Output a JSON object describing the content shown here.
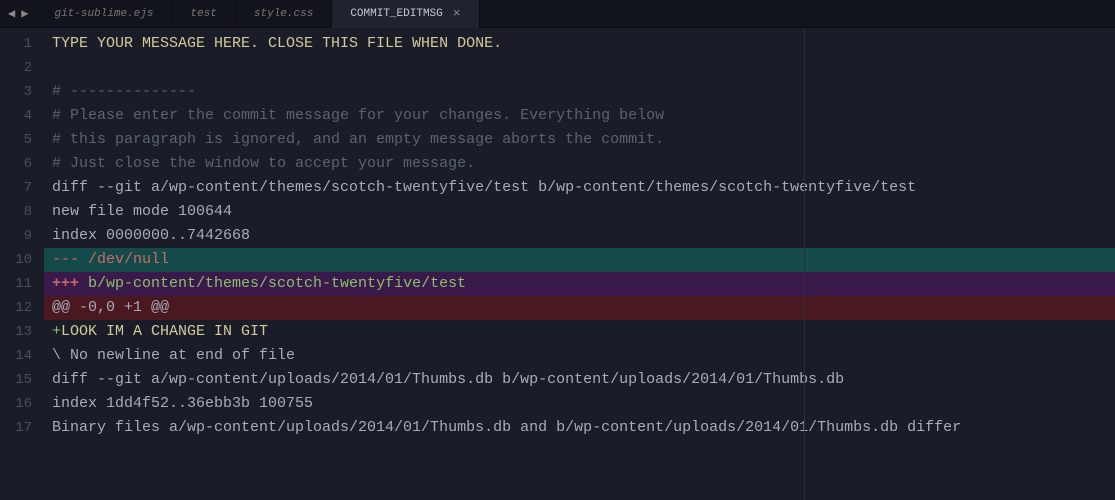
{
  "nav": {
    "back": "◀",
    "forward": "▶"
  },
  "tabs": [
    {
      "label": "git-sublime.ejs",
      "active": false
    },
    {
      "label": "test",
      "active": false
    },
    {
      "label": "style.css",
      "active": false
    },
    {
      "label": "COMMIT_EDITMSG",
      "active": true,
      "close": "×"
    }
  ],
  "editor": {
    "lines": [
      {
        "n": "1",
        "segs": [
          {
            "t": "TYPE YOUR MESSAGE HERE. CLOSE THIS FILE WHEN DONE.",
            "c": "c-wheat"
          }
        ]
      },
      {
        "n": "2",
        "segs": [
          {
            "t": "",
            "c": "c-plain"
          }
        ]
      },
      {
        "n": "3",
        "segs": [
          {
            "t": "# --------------",
            "c": "c-comment"
          }
        ]
      },
      {
        "n": "4",
        "segs": [
          {
            "t": "# Please enter the commit message for your changes. Everything below",
            "c": "c-comment"
          }
        ]
      },
      {
        "n": "5",
        "segs": [
          {
            "t": "# this paragraph is ignored, and an empty message aborts the commit.",
            "c": "c-comment"
          }
        ]
      },
      {
        "n": "6",
        "segs": [
          {
            "t": "# Just close the window to accept your message.",
            "c": "c-comment"
          }
        ]
      },
      {
        "n": "7",
        "segs": [
          {
            "t": "diff --git a/wp-content/themes/scotch-twentyfive/test b/wp-content/themes/scotch-twentyfive/test",
            "c": "c-plain"
          }
        ]
      },
      {
        "n": "8",
        "segs": [
          {
            "t": "new file mode 100644",
            "c": "c-plain"
          }
        ]
      },
      {
        "n": "9",
        "segs": [
          {
            "t": "index 0000000..7442668",
            "c": "c-plain"
          }
        ]
      },
      {
        "n": "10",
        "hl": "hl-teal",
        "segs": [
          {
            "t": "--- /dev/null",
            "c": "c-red"
          }
        ]
      },
      {
        "n": "11",
        "hl": "hl-purple",
        "segs": [
          {
            "t": "+++ ",
            "c": "c-redbold"
          },
          {
            "t": "b/wp-content/themes/scotch-twentyfive/test",
            "c": "c-green"
          }
        ]
      },
      {
        "n": "12",
        "hl": "hl-red",
        "segs": [
          {
            "t": "@@ -0,0 +1 @@",
            "c": "c-plain"
          }
        ]
      },
      {
        "n": "13",
        "segs": [
          {
            "t": "+",
            "c": "c-green"
          },
          {
            "t": "LOOK IM A CHANGE IN GIT",
            "c": "c-wheat"
          }
        ]
      },
      {
        "n": "14",
        "segs": [
          {
            "t": "\\ No newline at end of file",
            "c": "c-plain"
          }
        ]
      },
      {
        "n": "15",
        "segs": [
          {
            "t": "diff --git a/wp-content/uploads/2014/01/Thumbs.db b/wp-content/uploads/2014/01/Thumbs.db",
            "c": "c-plain"
          }
        ]
      },
      {
        "n": "16",
        "segs": [
          {
            "t": "index 1dd4f52..36ebb3b 100755",
            "c": "c-plain"
          }
        ]
      },
      {
        "n": "17",
        "segs": [
          {
            "t": "Binary files a/wp-content/uploads/2014/01/Thumbs.db and b/wp-content/uploads/2014/01/Thumbs.db differ",
            "c": "c-plain"
          }
        ]
      }
    ]
  }
}
